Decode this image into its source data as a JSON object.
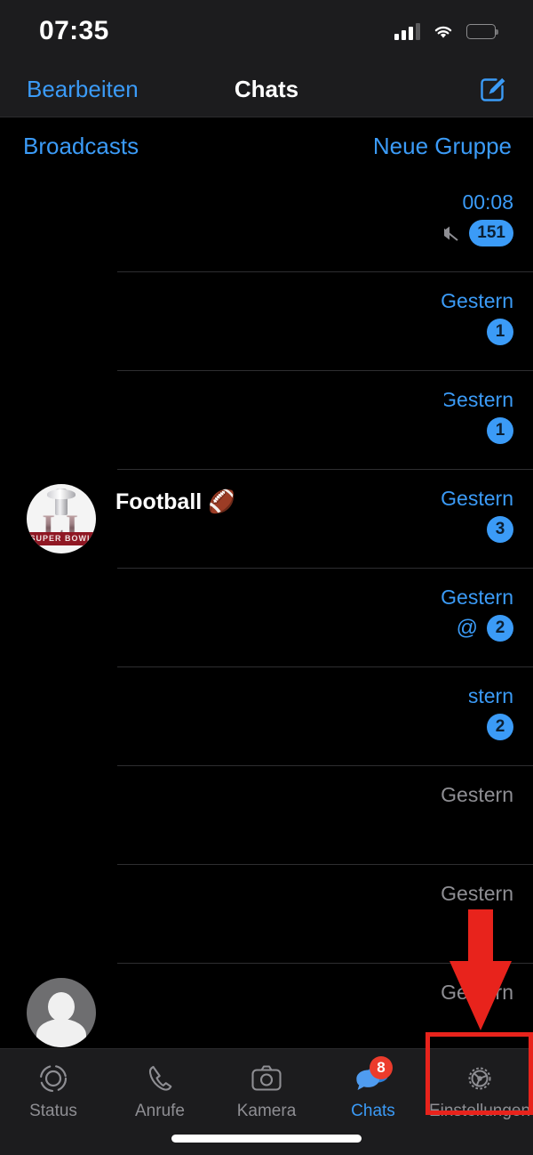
{
  "status_bar": {
    "time": "07:35",
    "icons": {
      "signal": "cellular-signal-icon",
      "wifi": "wifi-icon",
      "battery": "battery-low-power-icon"
    }
  },
  "nav_bar": {
    "left_button": "Bearbeiten",
    "title": "Chats",
    "compose_icon": "compose-new-chat-icon"
  },
  "sub_bar": {
    "broadcasts": "Broadcasts",
    "new_group": "Neue Gruppe"
  },
  "chats": [
    {
      "name": "",
      "time": "00:08",
      "time_state": "unread",
      "badge": "151",
      "muted": true,
      "mention": false,
      "avatar": "redacted"
    },
    {
      "name": "",
      "time": "Gestern",
      "time_state": "unread",
      "badge": "1",
      "muted": false,
      "mention": false,
      "avatar": "redacted"
    },
    {
      "name": "",
      "time": "Gestern",
      "time_state": "unread",
      "badge": "1",
      "muted": false,
      "mention": false,
      "avatar": "redacted"
    },
    {
      "name": "Football 🏈",
      "time": "Gestern",
      "time_state": "unread",
      "badge": "3",
      "muted": false,
      "mention": false,
      "avatar": "super-bowl-li-logo"
    },
    {
      "name": "",
      "time": "Gestern",
      "time_state": "unread",
      "badge": "2",
      "muted": false,
      "mention": true,
      "avatar": "redacted"
    },
    {
      "name": "",
      "time": "stern",
      "time_state": "unread",
      "badge": "2",
      "muted": false,
      "mention": false,
      "avatar": "redacted"
    },
    {
      "name": "",
      "time": "Gestern",
      "time_state": "read",
      "badge": "",
      "muted": false,
      "mention": false,
      "avatar": "redacted"
    },
    {
      "name": "",
      "time": "Gestern",
      "time_state": "read",
      "badge": "",
      "muted": false,
      "mention": false,
      "avatar": "redacted"
    },
    {
      "name": "",
      "time": "Gestern",
      "time_state": "read",
      "badge": "",
      "muted": false,
      "mention": false,
      "avatar": "default-person"
    }
  ],
  "tab_bar": {
    "items": [
      {
        "label": "Status",
        "icon": "status-rings-icon",
        "active": false,
        "badge": ""
      },
      {
        "label": "Anrufe",
        "icon": "phone-icon",
        "active": false,
        "badge": ""
      },
      {
        "label": "Kamera",
        "icon": "camera-icon",
        "active": false,
        "badge": ""
      },
      {
        "label": "Chats",
        "icon": "chat-bubbles-icon",
        "active": true,
        "badge": "8"
      },
      {
        "label": "Einstellungen",
        "icon": "gear-icon",
        "active": false,
        "badge": ""
      }
    ]
  },
  "annotations": {
    "arrow": "red-down-arrow",
    "highlight": "red-highlight-box-settings"
  },
  "colors": {
    "accent_blue": "#3b9bf7",
    "badge_red": "#ec3b2c",
    "annotation_red": "#e8231c",
    "battery_yellow": "#f2cf45",
    "bar_background": "#1c1c1e"
  }
}
